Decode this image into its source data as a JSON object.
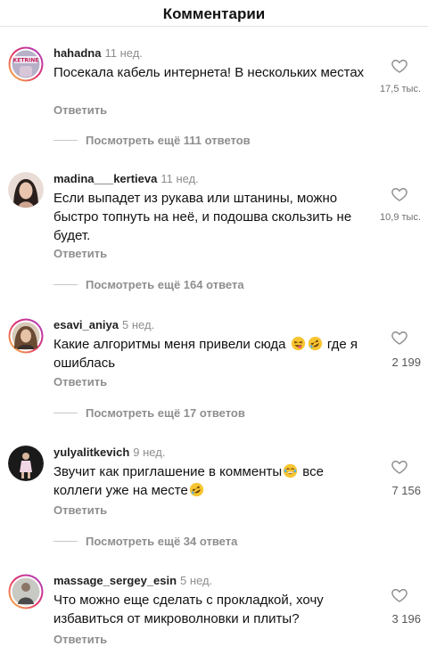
{
  "header": {
    "title": "Комментарии"
  },
  "comments": [
    {
      "username": "hahadna",
      "time": "11 нед.",
      "text": "Посекала кабель интернета! В нескольких местах",
      "likes": "17,5 тыс.",
      "reply_label": "Ответить",
      "view_replies": "Посмотреть ещё 111 ответов",
      "avatar_label": "KETRINE"
    },
    {
      "username": "madina___kertieva",
      "time": "11 нед.",
      "text": "Если выпадет из рукава или штанины, можно быстро топнуть на неё, и подошва скользить не будет.",
      "likes": "10,9 тыс.",
      "reply_label": "Ответить",
      "view_replies": "Посмотреть ещё 164 ответа"
    },
    {
      "username": "esavi_aniya",
      "time": "5 нед.",
      "text_before": "Какие алгоритмы меня привели сюда ",
      "text_after": " где я ошиблась",
      "emoji_names": [
        "face-with-tongue-laughing-emoji",
        "rolling-on-floor-laughing-emoji"
      ],
      "likes": "2 199",
      "reply_label": "Ответить",
      "view_replies": "Посмотреть ещё 17 ответов"
    },
    {
      "username": "yulyalitkevich",
      "time": "9 нед.",
      "text_part1": "Звучит как приглашение в комменты",
      "text_part2": " все коллеги уже на месте",
      "emoji_names": [
        "grimacing-sweat-emoji",
        "rolling-on-floor-laughing-emoji"
      ],
      "likes": "7 156",
      "reply_label": "Ответить",
      "view_replies": "Посмотреть ещё 34 ответа"
    },
    {
      "username": "massage_sergey_esin",
      "time": "5 нед.",
      "text": "Что можно еще сделать с прокладкой, хочу избавиться от микроволновки и плиты?",
      "likes": "3 196",
      "reply_label": "Ответить"
    }
  ],
  "colors": {
    "text": "#111111",
    "muted": "#8e8e8e",
    "divider": "#c7c7c7",
    "emoji_yellow": "#f7c531"
  },
  "icons": {
    "like": "heart-outline-icon"
  }
}
